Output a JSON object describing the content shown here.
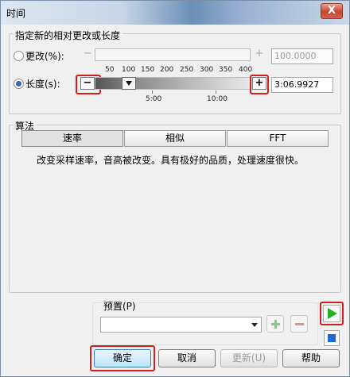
{
  "window": {
    "title": "时间",
    "close_label": "X"
  },
  "relative_group": {
    "title": "指定新的相对更改或长度"
  },
  "change_row": {
    "label": "更改(%):",
    "minus": "−",
    "plus": "+",
    "ticks": [
      "50",
      "100",
      "150",
      "200",
      "250",
      "300",
      "350",
      "400"
    ],
    "value": "100.0000",
    "selected": false
  },
  "length_row": {
    "label": "长度(s):",
    "minus": "−",
    "plus": "+",
    "ticks": [
      "5:00",
      "10:00"
    ],
    "value": "3:06.9927",
    "selected": true
  },
  "algorithm_group": {
    "title": "算法",
    "tabs": [
      {
        "label": "速率",
        "active": true
      },
      {
        "label": "相似",
        "active": false
      },
      {
        "label": "FFT",
        "active": false
      }
    ],
    "description": "改变采样速率，音高被改变。具有极好的品质，处理速度很快。"
  },
  "preset": {
    "label": "预置(P)",
    "value": ""
  },
  "buttons": {
    "ok": "确定",
    "cancel": "取消",
    "update": "更新(U)",
    "help": "帮助"
  },
  "icons": {
    "play": "play-icon",
    "stop": "stop-icon",
    "add_preset": "plus-icon",
    "remove_preset": "minus-icon"
  },
  "colors": {
    "play": "#23b023",
    "stop": "#1f67d6",
    "highlight": "#d11f1f"
  }
}
